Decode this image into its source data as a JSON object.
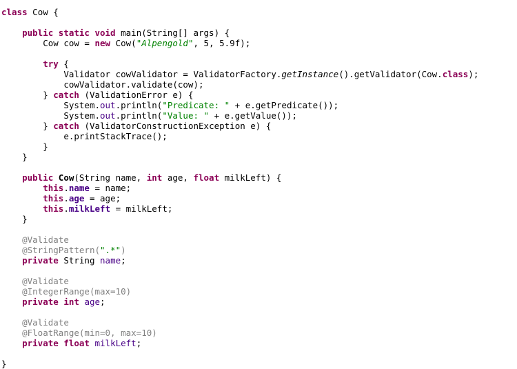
{
  "code": {
    "blank": "",
    "sp": " ",
    "dot": ".",
    "sc": ";",
    "cb": "}",
    "ind1": "    ",
    "ind2": "        ",
    "ind3": "            ",
    "out": "out",
    "t00": "class",
    "t01": " Cow {",
    "t02": "public",
    "t03": "static",
    "t04": "void",
    "t05": " main(String[] args) {",
    "t06": "Cow cow = ",
    "t07": "new",
    "t08": " Cow(",
    "t09": "\"Alpengold\"",
    "t10": ", 5, 5.9f);",
    "t11": "try",
    "t12": " {",
    "t13": "Validator cowValidator = ValidatorFactory.",
    "t14": "getInstance",
    "t15": "().getValidator(Cow.",
    "t16": "class",
    "t17": ");",
    "t18": "cowValidator.validate(cow);",
    "t19": "} ",
    "t20": "catch",
    "t21": " (ValidationError e) {",
    "t22a": "System.",
    "t22b": ".println(",
    "t23": "\"Predicate: \"",
    "t24": " + e.getPredicate());",
    "t25": "\"Value: \"",
    "t26": " + e.getValue());",
    "t27": " (ValidatorConstructionException e) {",
    "t28": "e.printStackTrace();",
    "t29a": "Cow",
    "t29b": "(String name, ",
    "t30": "int",
    "t31": " age, ",
    "t32": "float",
    "t33": " milkLeft) {",
    "t34": "this",
    "t35": "name",
    "t36": " = name;",
    "t37": "age",
    "t38": " = age;",
    "t39": "milkLeft",
    "t40": " = milkLeft;",
    "t41": "@Validate",
    "t42a": "@StringPattern(",
    "t42b": "\".*\"",
    "t42c": ")",
    "t43": "private",
    "t44": " String ",
    "t45": "@IntegerRange(max=10)",
    "t46": "@FloatRange(min=0, max=10)"
  }
}
